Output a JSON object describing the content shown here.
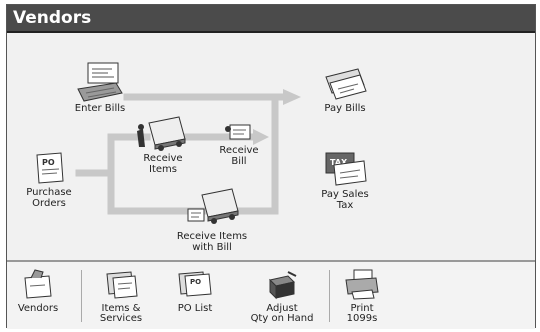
{
  "window": {
    "title": "Vendors"
  },
  "flow": {
    "enter_bills": "Enter Bills",
    "purchase_orders": "Purchase\nOrders",
    "receive_items": "Receive\nItems",
    "receive_bill": "Receive\nBill",
    "receive_items_with_bill": "Receive Items\nwith Bill",
    "pay_bills": "Pay Bills",
    "pay_sales_tax": "Pay Sales\nTax"
  },
  "toolbar": {
    "vendors": "Vendors",
    "items_services": "Items &\nServices",
    "po_list": "PO List",
    "adjust_qty": "Adjust\nQty on Hand",
    "print_1099s": "Print\n1099s"
  },
  "icons": {
    "enter_bills": "bill-keyboard-icon",
    "purchase_orders": "purchase-order-icon",
    "receive_items": "delivery-truck-icon",
    "receive_bill": "bill-icon",
    "receive_items_with_bill": "truck-with-bill-icon",
    "pay_bills": "checks-icon",
    "pay_sales_tax": "tax-form-icon"
  },
  "colors": {
    "titlebar": "#4b4b4b",
    "flow_line": "#c8c8c8"
  }
}
